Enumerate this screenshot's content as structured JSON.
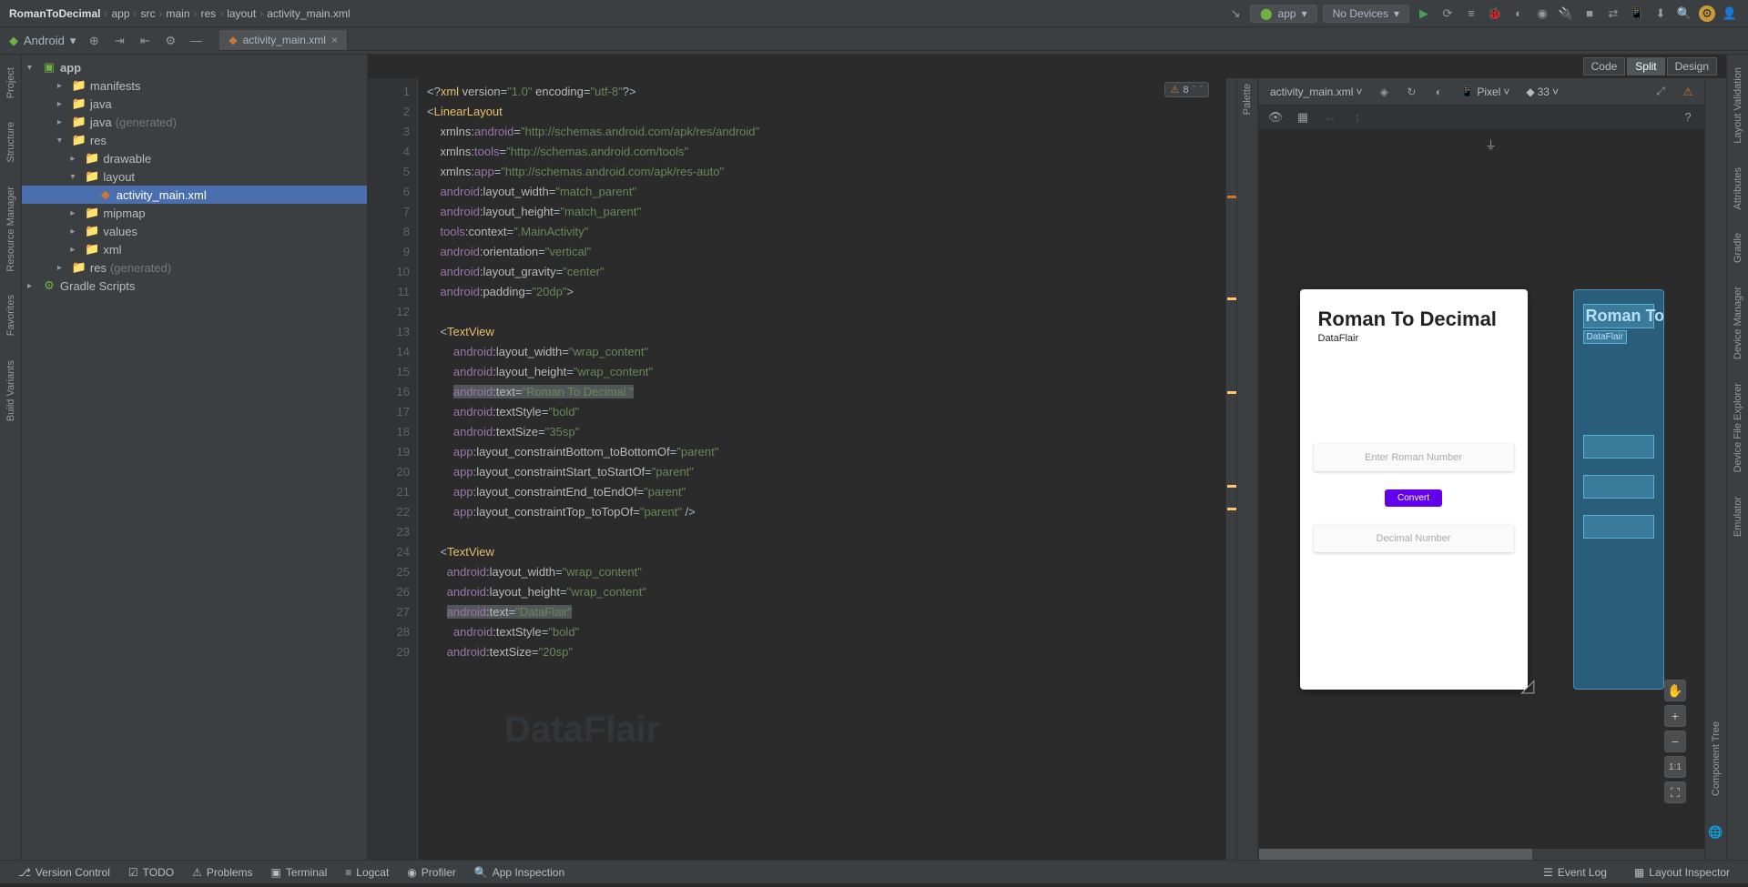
{
  "breadcrumbs": [
    "RomanToDecimal",
    "app",
    "src",
    "main",
    "res",
    "layout",
    "activity_main.xml"
  ],
  "run_config": "app",
  "device_selector": "No Devices",
  "android_label": "Android",
  "tab": {
    "name": "activity_main.xml"
  },
  "project_tree": {
    "root": "app",
    "items": [
      {
        "label": "manifests",
        "type": "folder",
        "indent": 2
      },
      {
        "label": "java",
        "type": "pkg",
        "indent": 2
      },
      {
        "label": "java",
        "gen": "(generated)",
        "type": "pkg",
        "indent": 2
      },
      {
        "label": "res",
        "type": "folder",
        "indent": 2,
        "expanded": true
      },
      {
        "label": "drawable",
        "type": "folder",
        "indent": 3
      },
      {
        "label": "layout",
        "type": "folder",
        "indent": 3,
        "expanded": true
      },
      {
        "label": "activity_main.xml",
        "type": "xml",
        "indent": 4,
        "selected": true
      },
      {
        "label": "mipmap",
        "type": "folder",
        "indent": 3
      },
      {
        "label": "values",
        "type": "folder",
        "indent": 3
      },
      {
        "label": "xml",
        "type": "folder",
        "indent": 3
      },
      {
        "label": "res",
        "gen": "(generated)",
        "type": "folder",
        "indent": 2
      }
    ],
    "gradle": "Gradle Scripts"
  },
  "editor": {
    "view_modes": {
      "code": "Code",
      "split": "Split",
      "design": "Design"
    },
    "warnings": "8",
    "lines": [
      {
        "n": 1,
        "html": "<span class='punct'>&lt;?</span><span class='tag'>xml</span> <span class='attr'>version</span><span class='punct'>=</span><span class='val'>\"1.0\"</span> <span class='attr'>encoding</span><span class='punct'>=</span><span class='val'>\"utf-8\"</span><span class='punct'>?&gt;</span>"
      },
      {
        "n": 2,
        "html": "<span class='punct'>&lt;</span><span class='tag'>LinearLayout</span>"
      },
      {
        "n": 3,
        "html": "    <span class='attr'>xmlns:</span><span class='attr-ns'>android</span><span class='punct'>=</span><span class='val'>\"http://schemas.android.com/apk/res/android\"</span>"
      },
      {
        "n": 4,
        "html": "    <span class='attr'>xmlns:</span><span class='attr-ns'>tools</span><span class='punct'>=</span><span class='val'>\"http://schemas.android.com/tools\"</span>"
      },
      {
        "n": 5,
        "html": "    <span class='attr'>xmlns:</span><span class='attr-ns'>app</span><span class='punct'>=</span><span class='val'>\"http://schemas.android.com/apk/res-auto\"</span>"
      },
      {
        "n": 6,
        "html": "    <span class='attr-ns'>android</span><span class='punct'>:</span><span class='attr'>layout_width</span><span class='punct'>=</span><span class='val'>\"match_parent\"</span>"
      },
      {
        "n": 7,
        "html": "    <span class='attr-ns'>android</span><span class='punct'>:</span><span class='attr'>layout_height</span><span class='punct'>=</span><span class='val'>\"match_parent\"</span>"
      },
      {
        "n": 8,
        "html": "    <span class='attr-ns'>tools</span><span class='punct'>:</span><span class='attr'>context</span><span class='punct'>=</span><span class='val'>\".MainActivity\"</span>"
      },
      {
        "n": 9,
        "html": "    <span class='attr-ns'>android</span><span class='punct'>:</span><span class='attr'>orientation</span><span class='punct'>=</span><span class='val'>\"vertical\"</span>"
      },
      {
        "n": 10,
        "html": "    <span class='attr-ns'>android</span><span class='punct'>:</span><span class='attr'>layout_gravity</span><span class='punct'>=</span><span class='val'>\"center\"</span>"
      },
      {
        "n": 11,
        "html": "    <span class='attr-ns'>android</span><span class='punct'>:</span><span class='attr'>padding</span><span class='punct'>=</span><span class='val'>\"20dp\"</span><span class='punct'>&gt;</span>"
      },
      {
        "n": 12,
        "html": ""
      },
      {
        "n": 13,
        "html": "    <span class='punct'>&lt;</span><span class='tag'>TextView</span>"
      },
      {
        "n": 14,
        "html": "        <span class='attr-ns'>android</span><span class='punct'>:</span><span class='attr'>layout_width</span><span class='punct'>=</span><span class='val'>\"wrap_content\"</span>"
      },
      {
        "n": 15,
        "html": "        <span class='attr-ns'>android</span><span class='punct'>:</span><span class='attr'>layout_height</span><span class='punct'>=</span><span class='val'>\"wrap_content\"</span>"
      },
      {
        "n": 16,
        "html": "        <span class='hl'><span class='attr-ns'>android</span><span class='punct'>:</span><span class='attr'>text</span><span class='punct'>=</span><span class='val'>\"Roman To Decimal \"</span></span>"
      },
      {
        "n": 17,
        "html": "        <span class='attr-ns'>android</span><span class='punct'>:</span><span class='attr'>textStyle</span><span class='punct'>=</span><span class='val'>\"bold\"</span>"
      },
      {
        "n": 18,
        "html": "        <span class='attr-ns'>android</span><span class='punct'>:</span><span class='attr'>textSize</span><span class='punct'>=</span><span class='val'>\"35sp\"</span>"
      },
      {
        "n": 19,
        "html": "        <span class='attr-ns'>app</span><span class='punct'>:</span><span class='attr'>layout_constraintBottom_toBottomOf</span><span class='punct'>=</span><span class='val'>\"parent\"</span>"
      },
      {
        "n": 20,
        "html": "        <span class='attr-ns'>app</span><span class='punct'>:</span><span class='attr'>layout_constraintStart_toStartOf</span><span class='punct'>=</span><span class='val'>\"parent\"</span>"
      },
      {
        "n": 21,
        "html": "        <span class='attr-ns'>app</span><span class='punct'>:</span><span class='attr'>layout_constraintEnd_toEndOf</span><span class='punct'>=</span><span class='val'>\"parent\"</span>"
      },
      {
        "n": 22,
        "html": "        <span class='attr-ns'>app</span><span class='punct'>:</span><span class='attr'>layout_constraintTop_toTopOf</span><span class='punct'>=</span><span class='val'>\"parent\"</span> <span class='punct'>/&gt;</span>"
      },
      {
        "n": 23,
        "html": ""
      },
      {
        "n": 24,
        "html": "    <span class='punct'>&lt;</span><span class='tag'>TextView</span>"
      },
      {
        "n": 25,
        "html": "      <span class='attr-ns'>android</span><span class='punct'>:</span><span class='attr'>layout_width</span><span class='punct'>=</span><span class='val'>\"wrap_content\"</span>"
      },
      {
        "n": 26,
        "html": "      <span class='attr-ns'>android</span><span class='punct'>:</span><span class='attr'>layout_height</span><span class='punct'>=</span><span class='val'>\"wrap_content\"</span>"
      },
      {
        "n": 27,
        "html": "      <span class='hl'><span class='attr-ns'>android</span><span class='punct'>:</span><span class='attr'>text</span><span class='punct'>=</span><span class='val'>\"DataFlair\"</span></span>"
      },
      {
        "n": 28,
        "html": "        <span class='attr-ns'>android</span><span class='punct'>:</span><span class='attr'>textStyle</span><span class='punct'>=</span><span class='val'>\"bold\"</span>"
      },
      {
        "n": 29,
        "html": "      <span class='attr-ns'>android</span><span class='punct'>:</span><span class='attr'>textSize</span><span class='punct'>=</span><span class='val'>\"20sp\"</span>"
      }
    ]
  },
  "design": {
    "file": "activity_main.xml",
    "device": "Pixel",
    "zoom": "33",
    "title": "Roman To Decimal",
    "subtitle": "DataFlair",
    "hint1": "Enter Roman Number",
    "button": "Convert",
    "hint2": "Decimal Number",
    "bp_title": "Roman To",
    "bp_sub": "DataFlair",
    "ratio": "1:1"
  },
  "left_rail": [
    "Project",
    "Structure",
    "Resource Manager",
    "Favorites",
    "Build Variants"
  ],
  "right_rail": [
    "Layout Validation",
    "Attributes",
    "Gradle",
    "Device Manager",
    "Device File Explorer",
    "Emulator"
  ],
  "mid_rails": {
    "palette": "Palette",
    "component_tree": "Component Tree"
  },
  "bottom": {
    "left": [
      "Version Control",
      "TODO",
      "Problems",
      "Terminal",
      "Logcat",
      "Profiler",
      "App Inspection"
    ],
    "right": [
      "Event Log",
      "Layout Inspector"
    ]
  }
}
